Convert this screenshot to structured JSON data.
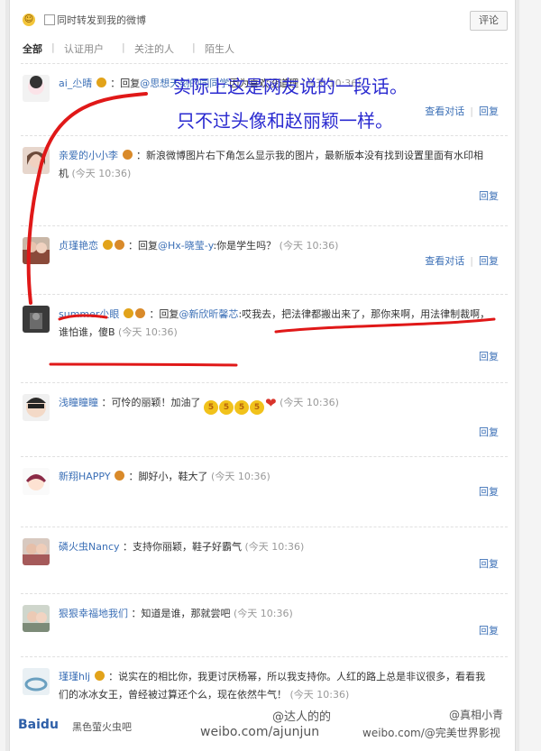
{
  "top": {
    "checkbox_label": "同时转发到我的微博",
    "comment_button": "评论"
  },
  "filters": [
    "全部",
    "认证用户",
    "关注的人",
    "陌生人"
  ],
  "annotations": {
    "line1": "实际上这是网友说的一段话。",
    "line2": "只不过头像和赵丽颖一样。"
  },
  "actions": {
    "view": "查看对话",
    "reply": "回复",
    "sep": "|"
  },
  "comments": [
    {
      "user": "ai_尐晴",
      "text_pre": "：回复",
      "mention": "@思想天刻的同同学",
      "text": "因为喜欢没道理",
      "time": "(今天 10:36)"
    },
    {
      "user": "亲爱的小小李",
      "text": "：新浪微博图片右下角怎么显示我的图片，最新版本没有找到设置里面有水印相机",
      "time": "(今天 10:36)"
    },
    {
      "user": "贞瑾艳恋",
      "text_pre": "：回复",
      "mention": "@Hx-晓莹-y",
      "text": ":你是学生吗？",
      "time": "(今天 10:36)"
    },
    {
      "user": "summer尐眼",
      "text_pre": "：回复",
      "mention": "@新欣昕馨芯",
      "text": ":哎我去，把法律都搬出来了，那你来啊，用法律制裁啊，谁怕谁，傻B",
      "time": "(今天 10:36)"
    },
    {
      "user": "浅瞳瞳瞳",
      "text": "：可怜的丽颖！加油了",
      "time": "(今天 10:36)"
    },
    {
      "user": "新翔HAPPY",
      "text": "：脚好小，鞋大了",
      "time": "(今天 10:36)"
    },
    {
      "user": "磷火虫Nancy",
      "text": "：支持你丽颖，鞋子好霸气",
      "time": "(今天 10:36)"
    },
    {
      "user": "狠狠幸福地我们",
      "text": "：知道是谁，那就尝吧",
      "time": "(今天 10:36)"
    },
    {
      "user": "瑾瑾hlj",
      "text": "：说实在的相比你，我更讨厌杨幂，所以我支持你。人红的路上总是非议很多，看看我们的冰冰女王，曾经被过算还个么，现在依然牛气！",
      "time": "(今天 10:36)"
    }
  ],
  "footer": {
    "baidu": "Baidu",
    "left_tag": "黑色萤火虫吧",
    "handle": "@达人的的",
    "site": "weibo.com/ajunjun",
    "site2": "weibo.com/@完美世界影视",
    "right_handle": "@真相小青"
  },
  "colors": {
    "link": "#3b6fb6",
    "annotation_ink": "#2a2ad0",
    "marker_red": "#e01818"
  }
}
